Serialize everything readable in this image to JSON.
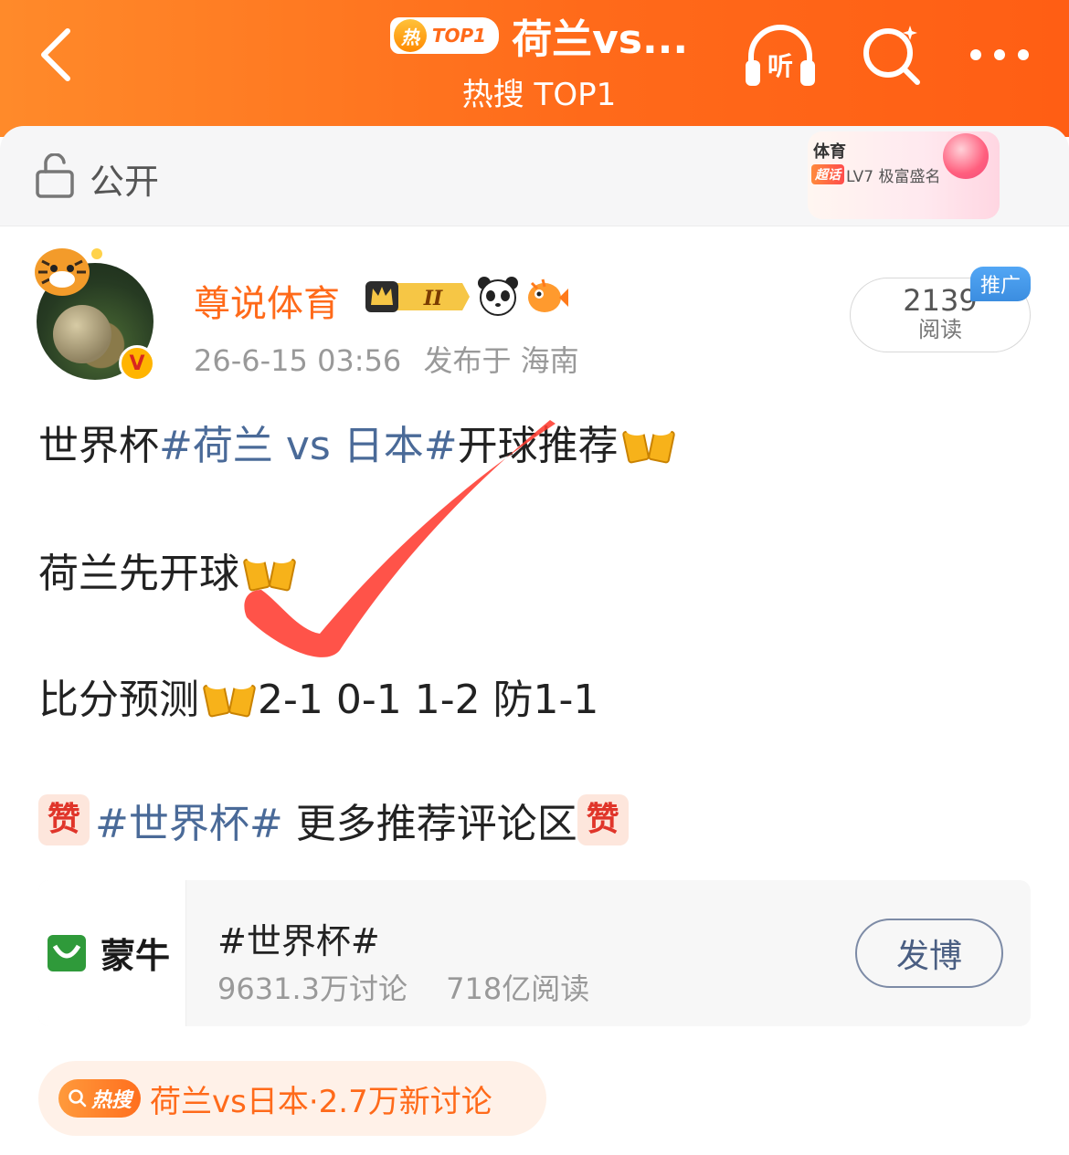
{
  "header": {
    "badge_label": "TOP1",
    "badge_fire": "热",
    "title": "荷兰vs...",
    "subtitle": "热搜 TOP1",
    "listen_label": "听"
  },
  "visibility": {
    "label": "公开"
  },
  "super_topic": {
    "title": "体育",
    "tag": "超话",
    "level": "LV7 极富盛名"
  },
  "author": {
    "name": "尊说体育",
    "crown_level": "II",
    "verified_mark": "V",
    "time": "26-6-15 03:56",
    "location": "发布于 海南"
  },
  "reads": {
    "count": "2139",
    "label": "阅读",
    "promo": "推广"
  },
  "post": {
    "line1": {
      "prefix": "世界杯",
      "topic": "#荷兰 vs 日本#",
      "suffix": "开球推荐"
    },
    "line2": "荷兰先开球",
    "line3": {
      "prefix": "比分预测",
      "suffix": "2-1 0-1 1-2 防1-1"
    },
    "line4": {
      "emoji": "赞",
      "topic": "#世界杯#",
      "suffix": " 更多推荐评论区"
    }
  },
  "topic_card": {
    "logo_text": "蒙牛",
    "title": "#世界杯#",
    "discussions": "9631.3万讨论",
    "reads": "718亿阅读",
    "button": "发博"
  },
  "hot_search": {
    "tag": "热搜",
    "text": "荷兰vs日本·2.7万新讨论"
  },
  "colors": {
    "header_orange": "#ff6a1a",
    "author_orange": "#ff6a1a",
    "topic_blue": "#4a6a98",
    "annotation_red": "#ff3b30"
  }
}
